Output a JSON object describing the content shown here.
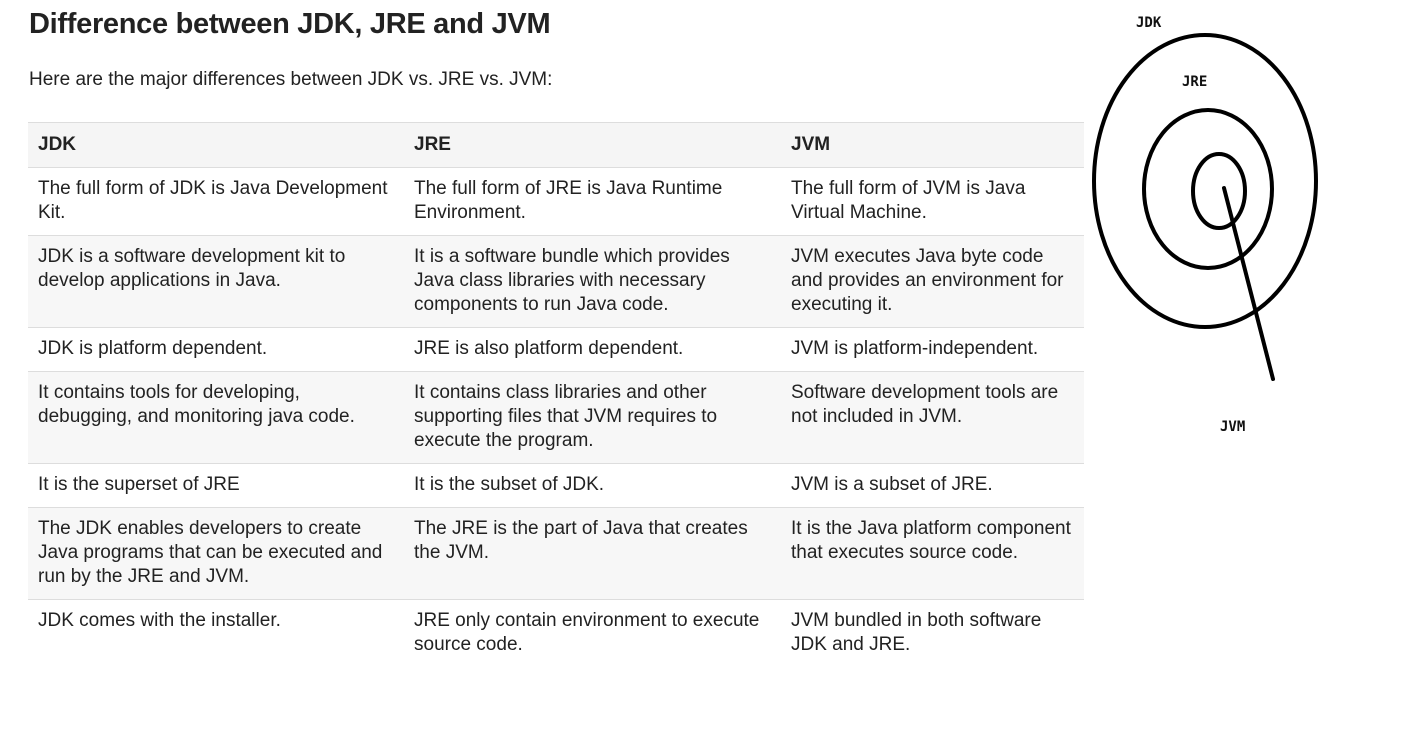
{
  "title": "Difference between JDK, JRE and JVM",
  "intro": "Here are the major differences between JDK vs. JRE vs. JVM:",
  "table": {
    "headers": [
      "JDK",
      "JRE",
      "JVM"
    ],
    "rows": [
      [
        "The full form of JDK is Java Development Kit.",
        "The full form of JRE is Java Runtime Environment.",
        "The full form of JVM is Java Virtual Machine."
      ],
      [
        "JDK is a software development kit to develop applications in Java.",
        "It is a software bundle which provides Java class libraries with necessary components to run Java code.",
        "JVM executes Java byte code and provides an environment for executing it."
      ],
      [
        "JDK is platform dependent.",
        "JRE is also platform dependent.",
        "JVM is platform-independent."
      ],
      [
        "It contains tools for developing, debugging, and monitoring java code.",
        "It contains class libraries and other supporting files that JVM requires to execute the program.",
        "Software development tools are not included in JVM."
      ],
      [
        "It is the superset of JRE",
        "It is the subset of JDK.",
        "JVM is a subset of JRE."
      ],
      [
        "The JDK enables developers to create Java programs that can be executed and run by the JRE and JVM.",
        "The JRE is the part of Java that creates the JVM.",
        "It is the Java platform component that executes source code."
      ],
      [
        "JDK comes with the installer.",
        "JRE only contain environment to execute source code.",
        "JVM bundled in both software JDK and JRE."
      ]
    ]
  },
  "diagram": {
    "labels": {
      "outer": "JDK",
      "middle": "JRE",
      "inner": "JVM"
    },
    "stroke_color": "#000000"
  }
}
